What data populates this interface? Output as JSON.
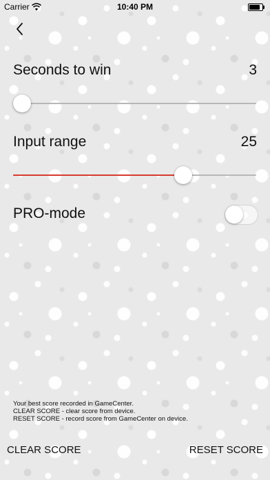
{
  "status_bar": {
    "carrier": "Carrier",
    "time": "10:40 PM",
    "wifi_icon": "wifi-icon",
    "battery_icon": "battery-icon",
    "battery_level": 0.9
  },
  "nav": {
    "back_icon": "chevron-left-icon"
  },
  "settings": {
    "seconds_to_win": {
      "label": "Seconds to win",
      "value": "3",
      "slider_fraction": 0.03
    },
    "input_range": {
      "label": "Input range",
      "value": "25",
      "slider_fraction": 0.7,
      "accent_color": "#d63a2f"
    },
    "pro_mode": {
      "label": "PRO-mode",
      "enabled": false
    }
  },
  "info": {
    "lines": [
      "Your best score recorded in GameCenter.",
      "CLEAR SCORE - clear score from device.",
      "RESET SCORE - record score from GameCenter on device."
    ]
  },
  "buttons": {
    "clear_score": "CLEAR SCORE",
    "reset_score": "RESET SCORE"
  }
}
